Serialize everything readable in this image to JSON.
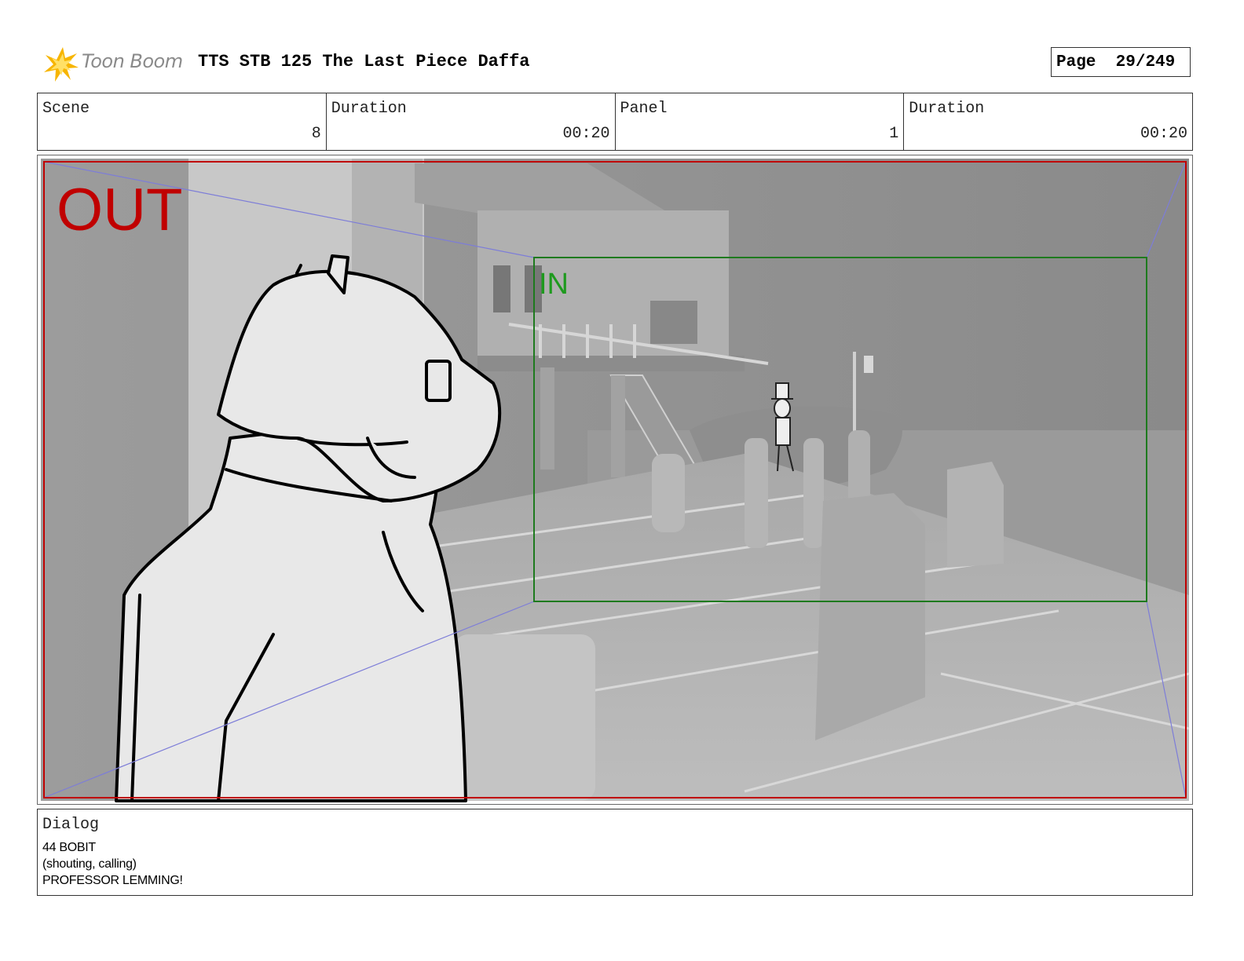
{
  "header": {
    "logo_text": "Toon Boom",
    "title": "TTS STB 125 The Last Piece Daffa",
    "page_label": "Page",
    "page_number": "29/249"
  },
  "info": {
    "scene_label": "Scene",
    "scene_value": "8",
    "scene_duration_label": "Duration",
    "scene_duration_value": "00:20",
    "panel_label": "Panel",
    "panel_value": "1",
    "panel_duration_label": "Duration",
    "panel_duration_value": "00:20"
  },
  "frame": {
    "out_label": "OUT",
    "in_label": "IN",
    "out_color": "#c00000",
    "in_color": "#1e9a1e"
  },
  "dialog": {
    "label": "Dialog",
    "lines": [
      "44 BOBIT",
      "(shouting, calling)",
      "PROFESSOR LEMMING!"
    ]
  }
}
